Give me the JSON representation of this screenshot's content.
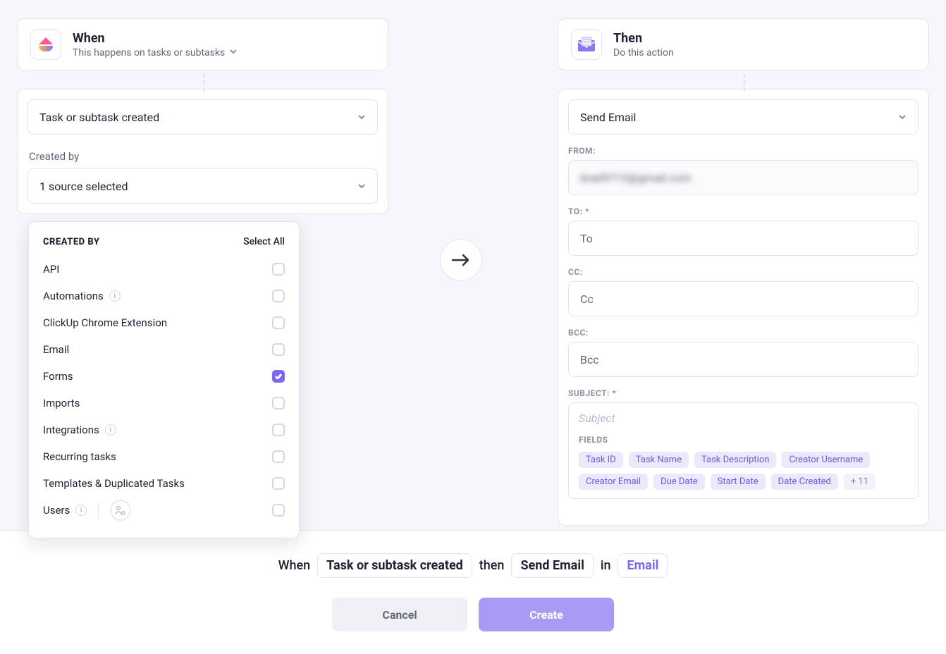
{
  "when": {
    "title": "When",
    "subtitle": "This happens on tasks or subtasks",
    "trigger_selected": "Task or subtask created",
    "created_by_label": "Created by",
    "created_by_summary": "1 source selected",
    "dropdown_title": "CREATED BY",
    "select_all_label": "Select All",
    "options": [
      {
        "label": "API",
        "checked": false,
        "info": false
      },
      {
        "label": "Automations",
        "checked": false,
        "info": true
      },
      {
        "label": "ClickUp Chrome Extension",
        "checked": false,
        "info": false
      },
      {
        "label": "Email",
        "checked": false,
        "info": false
      },
      {
        "label": "Forms",
        "checked": true,
        "info": false
      },
      {
        "label": "Imports",
        "checked": false,
        "info": false
      },
      {
        "label": "Integrations",
        "checked": false,
        "info": true
      },
      {
        "label": "Recurring tasks",
        "checked": false,
        "info": false
      },
      {
        "label": "Templates & Duplicated Tasks",
        "checked": false,
        "info": false
      },
      {
        "label": "Users",
        "checked": false,
        "info": true,
        "people": true
      }
    ]
  },
  "then": {
    "title": "Then",
    "subtitle": "Do this action",
    "action_selected": "Send Email",
    "fields": {
      "from_label": "FROM:",
      "from_value_blurred": "brad9713@gmail.com",
      "to_label": "TO: *",
      "to_placeholder": "To",
      "cc_label": "CC:",
      "cc_placeholder": "Cc",
      "bcc_label": "BCC:",
      "bcc_placeholder": "Bcc",
      "subject_label": "SUBJECT: *",
      "subject_placeholder": "Subject",
      "fields_label": "FIELDS",
      "chips": [
        "Task ID",
        "Task Name",
        "Task Description",
        "Creator Username",
        "Creator Email",
        "Due Date",
        "Start Date",
        "Date Created"
      ],
      "chips_more": "+ 11"
    }
  },
  "footer": {
    "when_word": "When",
    "when_value": "Task or subtask created",
    "then_word": "then",
    "then_value": "Send Email",
    "in_word": "in",
    "in_value": "Email",
    "cancel": "Cancel",
    "create": "Create"
  }
}
